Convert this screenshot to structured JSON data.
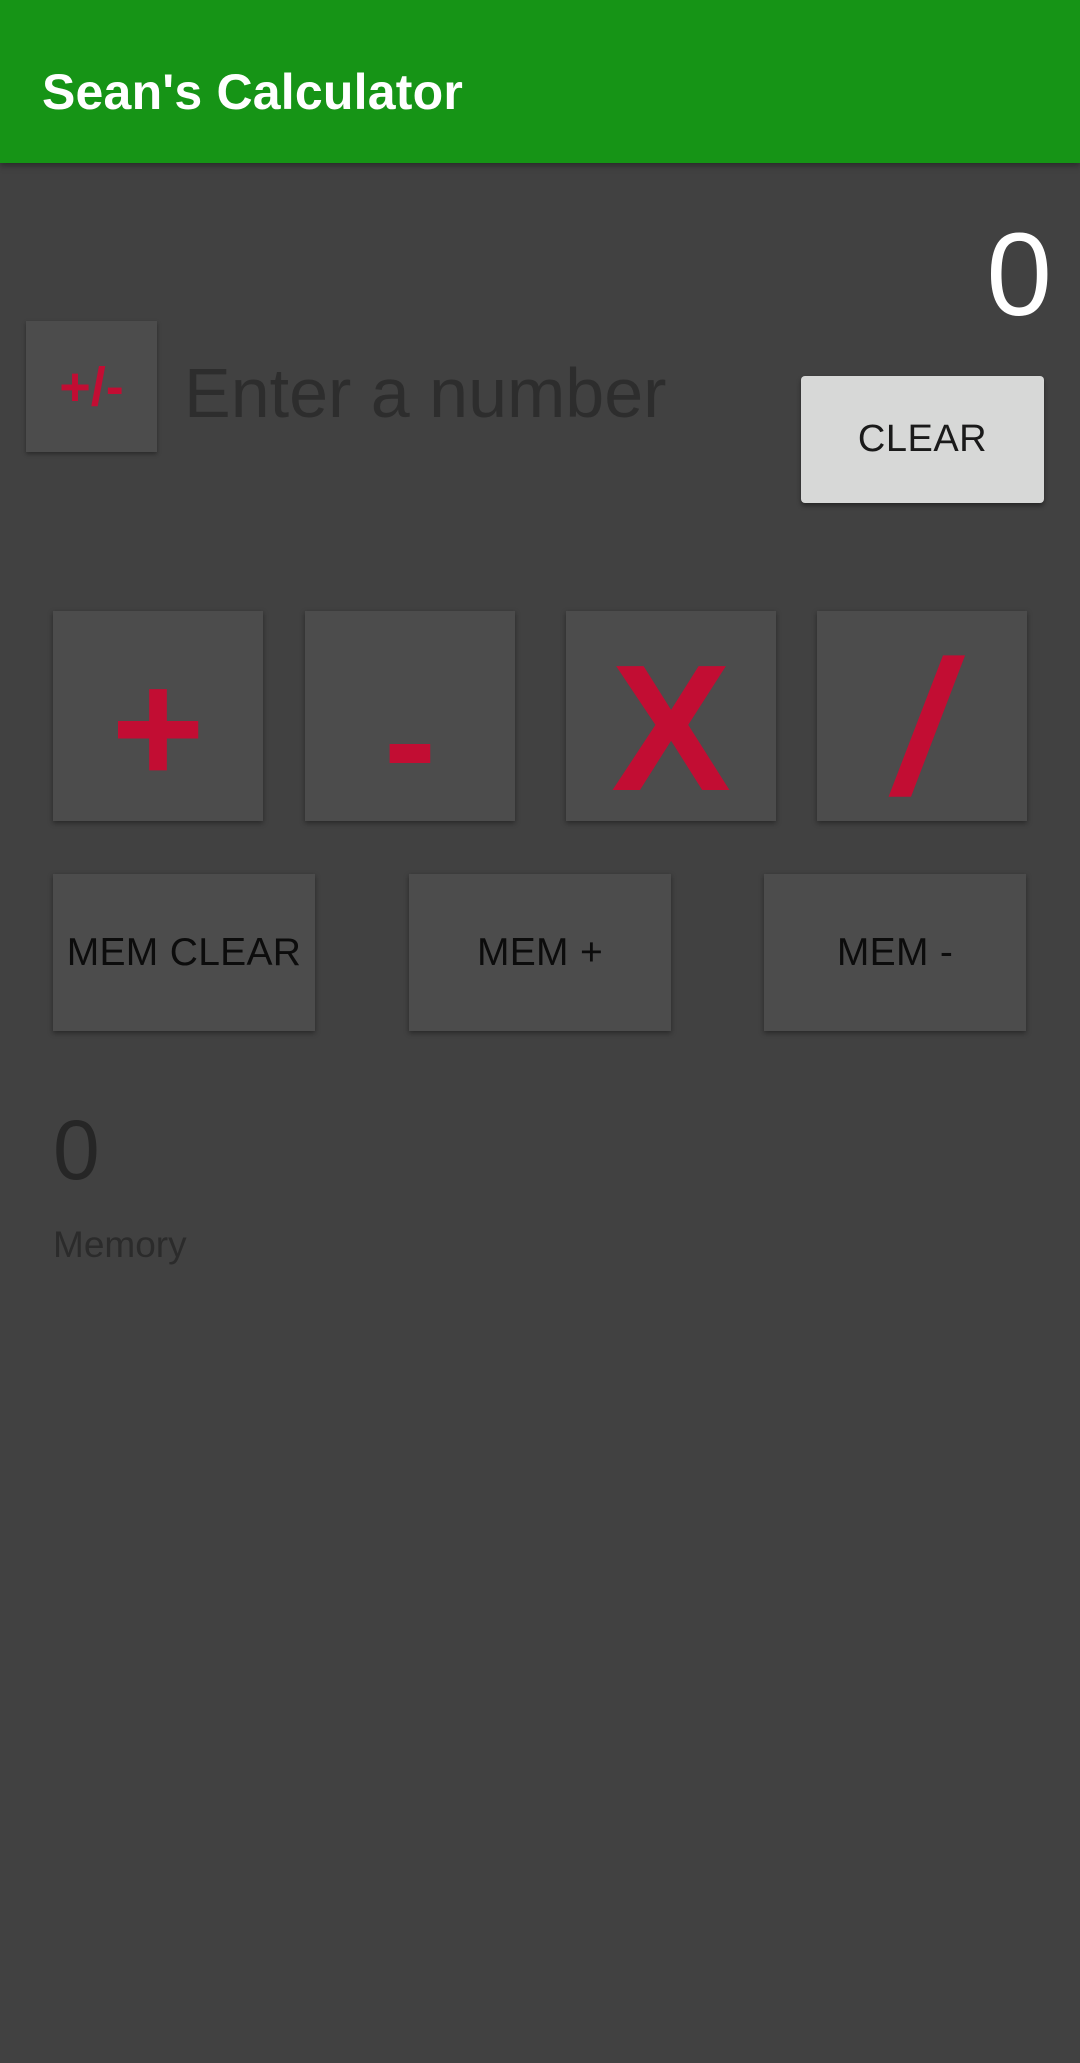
{
  "app_bar": {
    "title": "Sean's Calculator"
  },
  "display": {
    "result": "0"
  },
  "input": {
    "sign_toggle_label": "+/-",
    "placeholder": "Enter a number",
    "value": ""
  },
  "controls": {
    "clear_label": "CLEAR"
  },
  "operators": {
    "add_label": "+",
    "subtract_label": "-",
    "multiply_label": "X",
    "divide_label": "/"
  },
  "memory_controls": {
    "clear_label": "MEM CLEAR",
    "add_label": "MEM +",
    "subtract_label": "MEM -"
  },
  "memory": {
    "value": "0",
    "label": "Memory"
  },
  "colors": {
    "app_bar": "#169416",
    "background": "#414141",
    "accent": "#c20d33",
    "button_surface": "#4c4c4c",
    "clear_button": "#d7d8d7"
  }
}
